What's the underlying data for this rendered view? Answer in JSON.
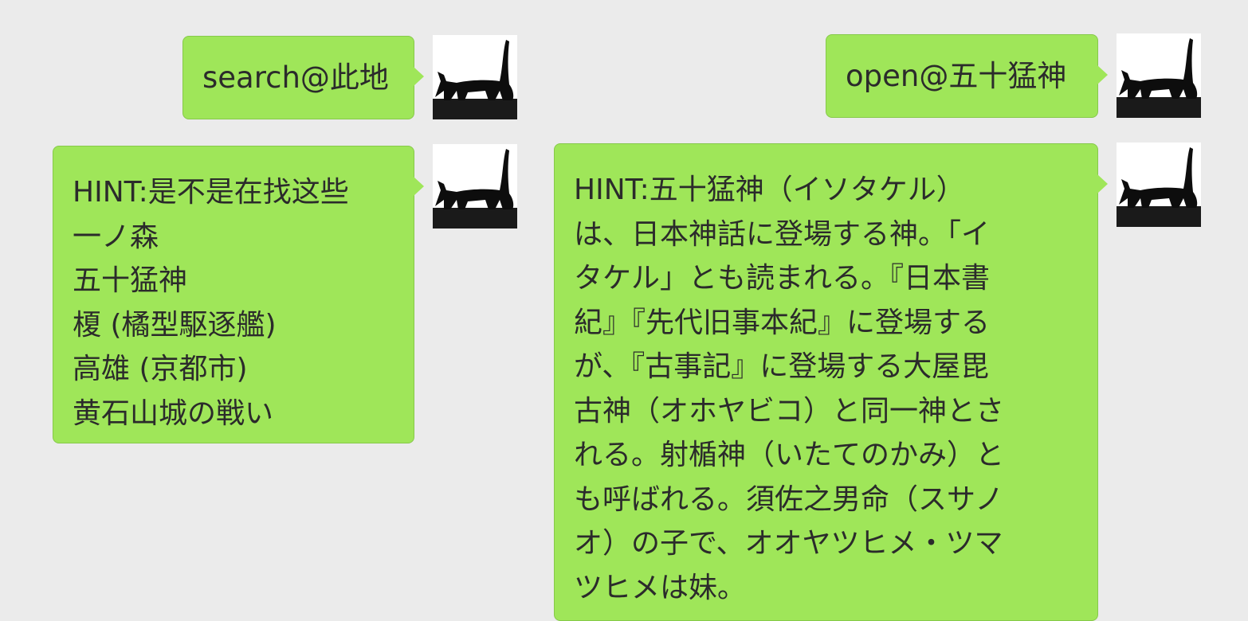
{
  "messages": [
    {
      "text": "search@此地",
      "avatar_icon": "black-cat-walking-icon"
    },
    {
      "lines": [
        "HINT:是不是在找这些",
        "一ノ森",
        "五十猛神",
        "榎 (橘型駆逐艦)",
        "高雄 (京都市)",
        "黄石山城の戦い"
      ],
      "avatar_icon": "black-cat-walking-icon"
    },
    {
      "text": "open@五十猛神",
      "avatar_icon": "black-cat-walking-icon"
    },
    {
      "lines": [
        "HINT:五十猛神（イソタケル）",
        "は、日本神話に登場する神。「イ",
        "タケル」とも読まれる。『日本書",
        "紀』『先代旧事本紀』に登場する",
        "が、『古事記』に登場する大屋毘",
        "古神（オホヤビコ）と同一神とさ",
        "れる。射楯神（いたてのかみ）と",
        "も呼ばれる。須佐之男命（スサノ",
        "オ）の子で、オオヤツヒメ・ツマ",
        "ツヒメは妹。"
      ],
      "avatar_icon": "black-cat-walking-icon"
    }
  ],
  "colors": {
    "background": "#ebebeb",
    "bubble": "#9fe659",
    "bubble_border": "#86c94a",
    "text": "#2b2b2b"
  }
}
